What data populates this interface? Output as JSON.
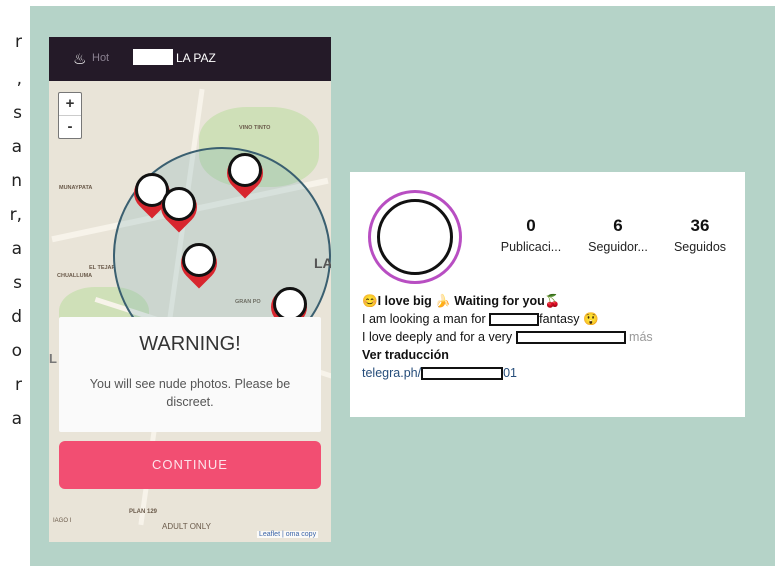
{
  "clipped_text": [
    "r",
    ",",
    "s",
    "a",
    "n",
    "r,",
    "a",
    "s",
    "d",
    "o",
    "r",
    "a"
  ],
  "app": {
    "tab_prefix": "Hot",
    "city": "LA PAZ",
    "zoom_in": "+",
    "zoom_out": "-",
    "map_labels": {
      "vino_tinto": "VINO TINTO",
      "munaypata": "MUNAYPATA",
      "el_tejar": "EL TEJAR",
      "chualluma": "CHUALLUMA",
      "gran_poder": "GRAN PO",
      "la": "LA",
      "alto": "L ALTO",
      "plan": "PLAN 129",
      "hijo": "IAGO I",
      "adult_only": "ADULT ONLY",
      "attribution": "Leaflet | oma copy"
    },
    "warning": {
      "title": "WARNING!",
      "message": "You will see nude photos. Please be discreet."
    },
    "continue_label": "CONTINUE"
  },
  "profile": {
    "stats": [
      {
        "value": "0",
        "label": "Publicaci..."
      },
      {
        "value": "6",
        "label": "Seguidor..."
      },
      {
        "value": "36",
        "label": "Seguidos"
      }
    ],
    "bio": {
      "line1_a": "I love big ",
      "line1_b": " Waiting for you",
      "line2_a": "I am looking a man for ",
      "line2_b": "fantasy ",
      "line3_a": "I love deeply and for a very ",
      "line3_b": " más",
      "translate": "Ver traducción",
      "link_a": "telegra.ph/",
      "link_b": "01"
    },
    "emoji": {
      "smile": "😊",
      "banana": "🍌",
      "cherries": "🍒",
      "face": "😲"
    }
  }
}
